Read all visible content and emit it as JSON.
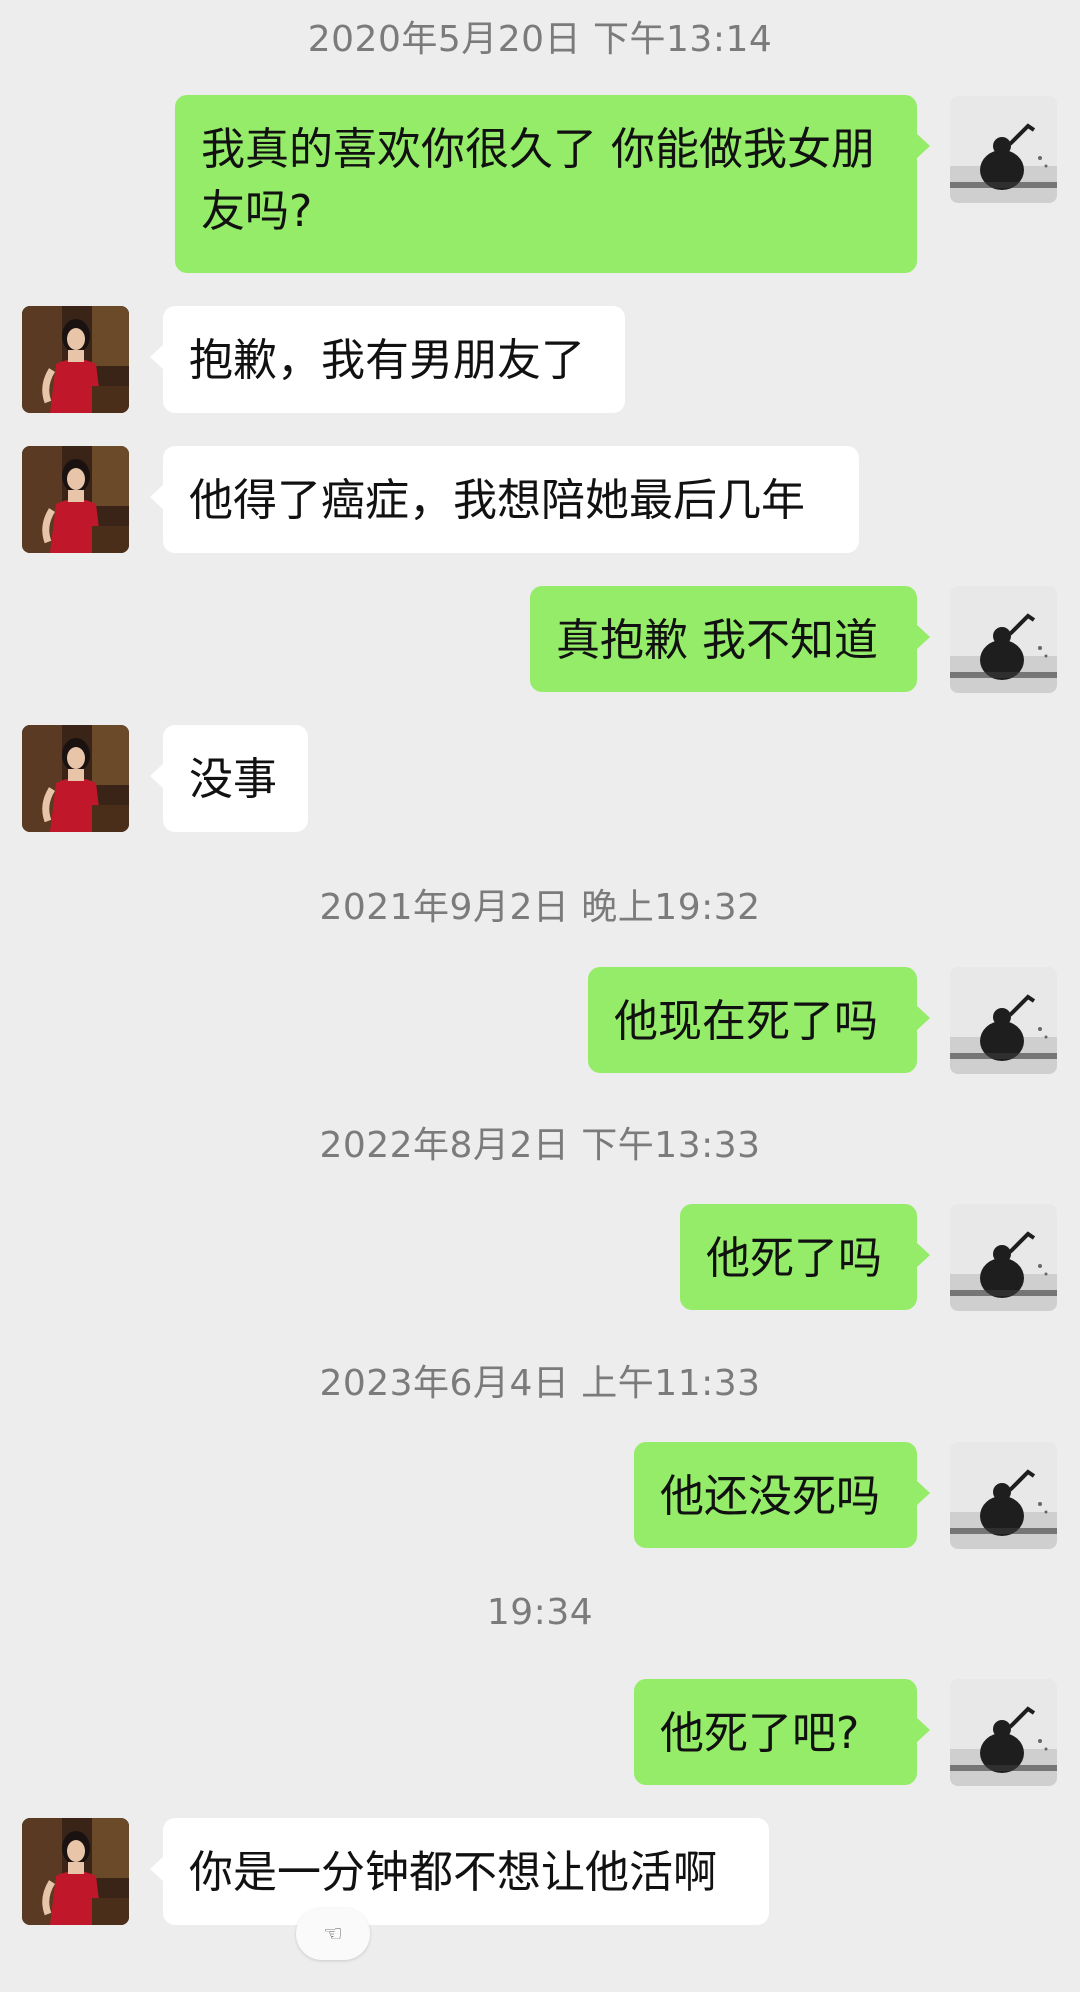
{
  "timestamps": {
    "t1": "2020年5月20日 下午13:14",
    "t2": "2021年9月2日 晚上19:32",
    "t3": "2022年8月2日 下午13:33",
    "t4": "2023年6月4日 上午11:33",
    "t5": "19:34"
  },
  "messages": {
    "m1": {
      "sender": "me",
      "text": "我真的喜欢你很久了 你能做我女朋友吗?"
    },
    "m2": {
      "sender": "her",
      "text": "抱歉，我有男朋友了"
    },
    "m3": {
      "sender": "her",
      "text": "他得了癌症，我想陪她最后几年"
    },
    "m4": {
      "sender": "me",
      "text": "真抱歉 我不知道"
    },
    "m5": {
      "sender": "her",
      "text": "没事"
    },
    "m6": {
      "sender": "me",
      "text": "他现在死了吗"
    },
    "m7": {
      "sender": "me",
      "text": "他死了吗"
    },
    "m8": {
      "sender": "me",
      "text": "他还没死吗"
    },
    "m9": {
      "sender": "me",
      "text": "他死了吧?"
    },
    "m10": {
      "sender": "her",
      "text": "你是一分钟都不想让他活啊"
    }
  },
  "reaction": {
    "icon": "hand-icon",
    "glyph": "☜"
  },
  "colors": {
    "background": "#ededed",
    "sent_bubble": "#95ec69",
    "received_bubble": "#ffffff",
    "timestamp_text": "#7b7b7b"
  }
}
